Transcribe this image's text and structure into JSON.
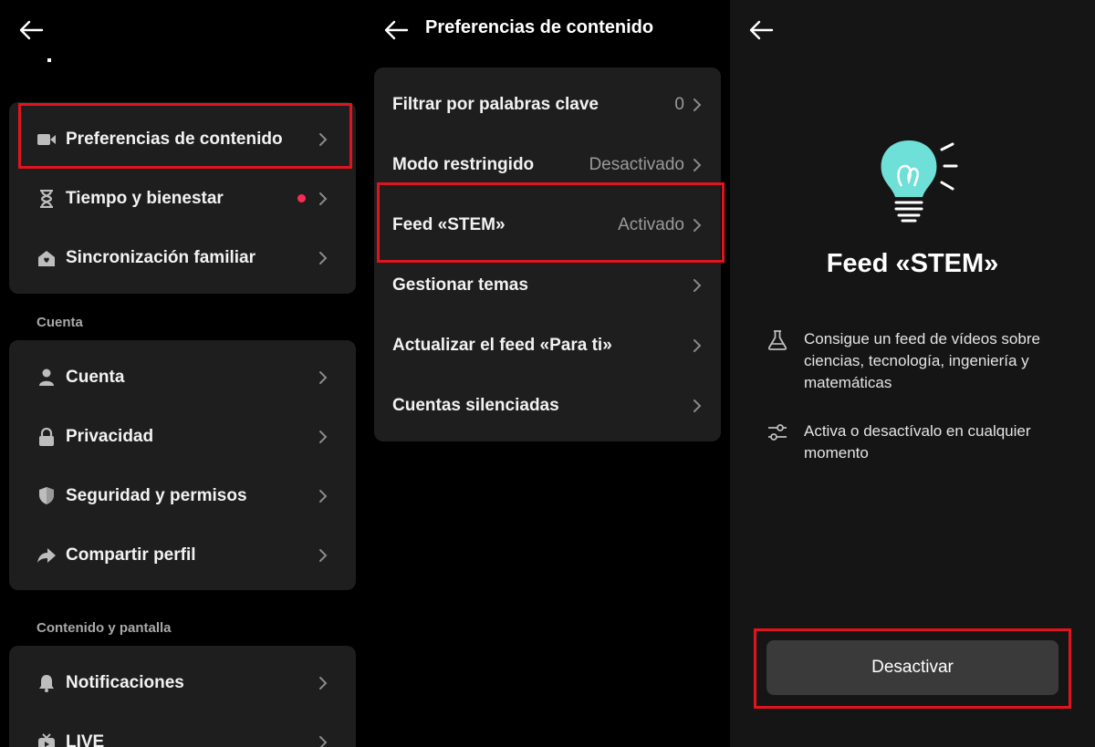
{
  "panel1": {
    "card1_items": [
      {
        "label": "Preferencias de contenido",
        "icon": "video-camera-icon"
      },
      {
        "label": "Tiempo y bienestar",
        "icon": "hourglass-icon"
      },
      {
        "label": "Sincronización familiar",
        "icon": "home-heart-icon"
      }
    ],
    "section_account": "Cuenta",
    "card2_items": [
      {
        "label": "Cuenta",
        "icon": "person-icon"
      },
      {
        "label": "Privacidad",
        "icon": "lock-icon"
      },
      {
        "label": "Seguridad y permisos",
        "icon": "shield-icon"
      },
      {
        "label": "Compartir perfil",
        "icon": "share-arrow-icon"
      }
    ],
    "section_content": "Contenido y pantalla",
    "card3_items": [
      {
        "label": "Notificaciones",
        "icon": "bell-icon"
      },
      {
        "label": "LIVE",
        "icon": "tv-icon"
      }
    ]
  },
  "panel2": {
    "title": "Preferencias de contenido",
    "items": [
      {
        "label": "Filtrar por palabras clave",
        "value": "0"
      },
      {
        "label": "Modo restringido",
        "value": "Desactivado"
      },
      {
        "label": "Feed «STEM»",
        "value": "Activado"
      },
      {
        "label": "Gestionar temas",
        "value": ""
      },
      {
        "label": "Actualizar el feed «Para ti»",
        "value": ""
      },
      {
        "label": "Cuentas silenciadas",
        "value": ""
      }
    ]
  },
  "panel3": {
    "title": "Feed «STEM»",
    "info1": "Consigue un feed de vídeos sobre ciencias, tecnología, ingeniería y matemáticas",
    "info2": "Activa o desactívalo en cualquier momento",
    "button_label": "Desactivar"
  },
  "colors": {
    "highlight": "#e0141e",
    "notification_dot": "#fe2c55",
    "bulb": "#6ee0d8",
    "card": "#1e1e1e",
    "button": "#3a3a3a"
  }
}
